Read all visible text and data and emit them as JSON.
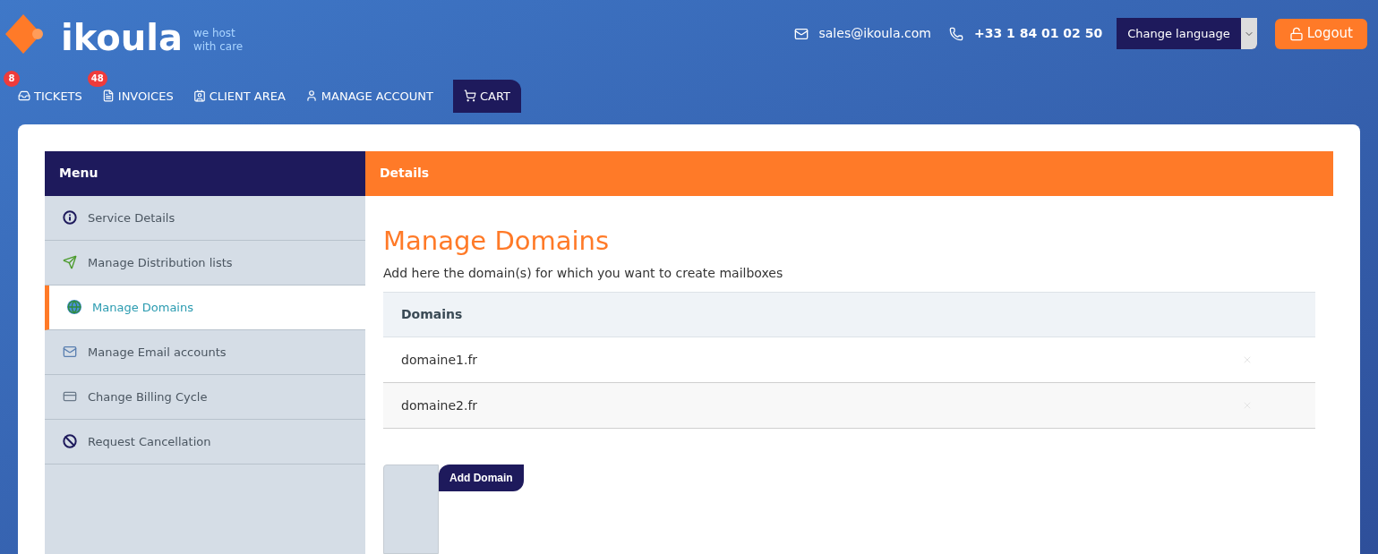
{
  "brand": {
    "name": "ikoula",
    "tagline_1": "we host",
    "tagline_2": "with care"
  },
  "contact": {
    "email": "sales@ikoula.com",
    "phone": "+33 1 84 01 02 50"
  },
  "language_select": {
    "value": "Change language"
  },
  "logout": "Logout",
  "nav": [
    {
      "kind": "tickets",
      "label": "TICKETS",
      "badge": "8",
      "selected": false
    },
    {
      "kind": "invoices",
      "label": "INVOICES",
      "badge": "48",
      "selected": false
    },
    {
      "kind": "client",
      "label": "CLIENT AREA",
      "selected": false
    },
    {
      "kind": "account",
      "label": "MANAGE ACCOUNT",
      "selected": false
    },
    {
      "kind": "cart",
      "label": "CART",
      "selected": true
    }
  ],
  "sidebar": {
    "title": "Menu",
    "items": [
      {
        "kind": "info",
        "label": "Service Details",
        "selected": false
      },
      {
        "kind": "distribution",
        "label": "Manage Distribution lists",
        "selected": false
      },
      {
        "kind": "globe",
        "label": "Manage Domains",
        "selected": true
      },
      {
        "kind": "email",
        "label": "Manage Email accounts",
        "selected": false
      },
      {
        "kind": "billing",
        "label": "Change Billing Cycle",
        "selected": false
      },
      {
        "kind": "cancel",
        "label": "Request Cancellation",
        "selected": false
      }
    ]
  },
  "details": {
    "title": "Details",
    "heading": "Manage Domains",
    "description": "Add here the domain(s) for which you want to create mailboxes",
    "table": {
      "columns": [
        "Domains"
      ],
      "rows": [
        [
          "domaine1.fr"
        ],
        [
          "domaine2.fr"
        ]
      ]
    },
    "add_button": "Add Domain"
  }
}
